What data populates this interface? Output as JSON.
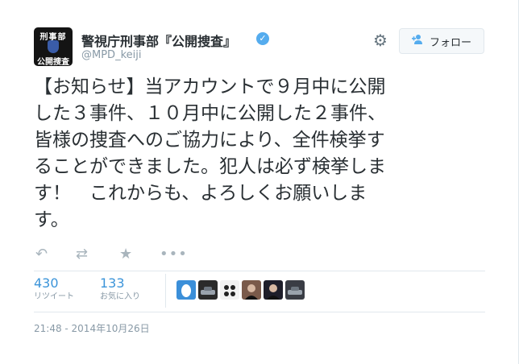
{
  "account": {
    "avatar_top": "刑事部",
    "avatar_bottom": "公開捜査",
    "display_name": "警視庁刑事部『公開捜査』",
    "handle": "@MPD_keiji",
    "verified_icon": "verified-badge"
  },
  "header": {
    "follow_label": "フォロー",
    "follow_icon": "add-person",
    "settings_icon": "gear"
  },
  "tweet": {
    "text": "【お知らせ】当アカウントで９月中に公開\nした３事件、１０月中に公開した２事件、\n皆様の捜査へのご協力により、全件検挙す\nることができました。犯人は必ず検挙しま\nす！　これからも、よろしくお願いしま\nす。"
  },
  "actions": {
    "reply": "↶",
    "retweet": "⇄",
    "favorite": "★",
    "more": "•••"
  },
  "stats": {
    "retweets_count": "430",
    "retweets_label": "リツイート",
    "favorites_count": "133",
    "favorites_label": "お気に入り"
  },
  "favoriters": [
    {
      "color": "#3b8fd9",
      "icon": "drop"
    },
    {
      "color": "#2b2b2b",
      "icon": "car"
    },
    {
      "color": "#f2f2f2",
      "icon": "face"
    },
    {
      "color": "#7a5a4a",
      "icon": "person"
    },
    {
      "color": "#1e1e2a",
      "icon": "person"
    },
    {
      "color": "#3a3d45",
      "icon": "car"
    }
  ],
  "timestamp": "21:48 - 2014年10月26日",
  "colors": {
    "accent": "#55acee",
    "link": "#3b94d9",
    "muted": "#8899a6"
  }
}
